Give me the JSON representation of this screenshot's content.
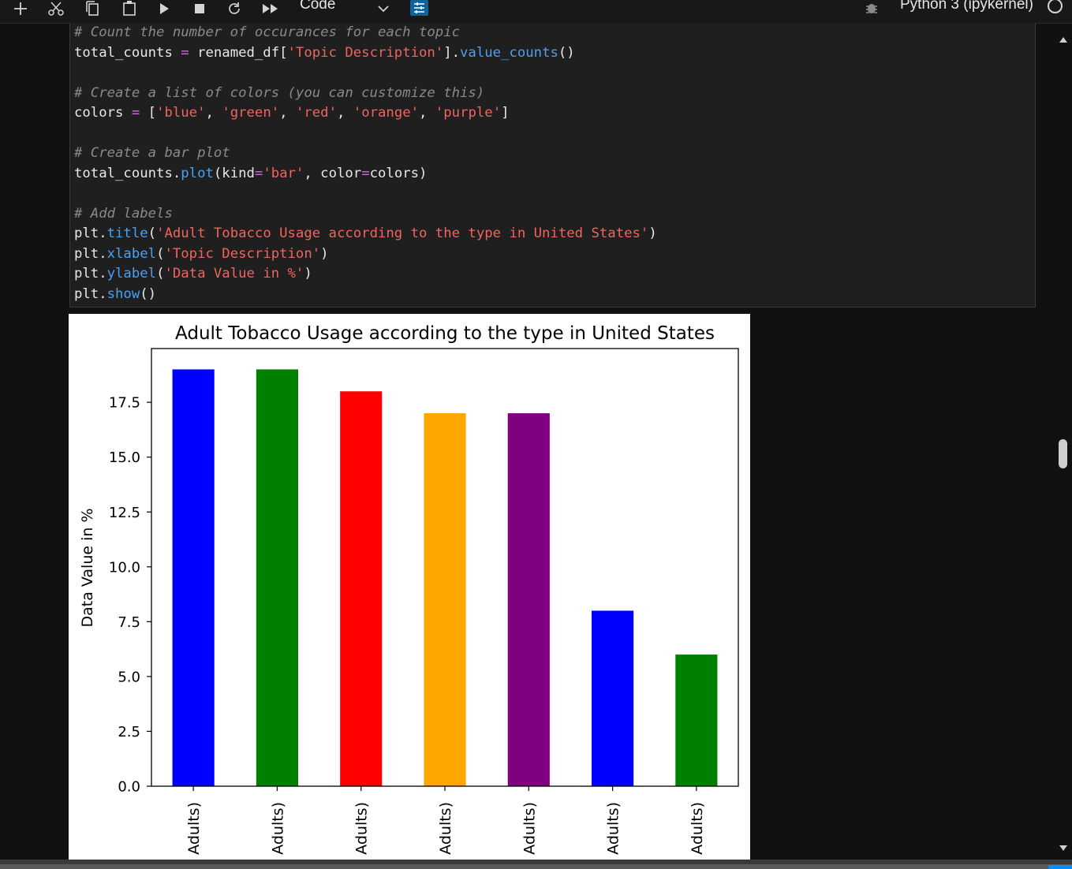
{
  "toolbar": {
    "cell_type": "Code",
    "kernel": "Python 3 (ipykernel)"
  },
  "code_lines": [
    [
      {
        "t": "# Count the number of occurances for each topic",
        "c": "cm"
      }
    ],
    [
      {
        "t": "total_counts ",
        "c": "pl"
      },
      {
        "t": "=",
        "c": "op"
      },
      {
        "t": " renamed_df[",
        "c": "pl"
      },
      {
        "t": "'Topic Description'",
        "c": "st"
      },
      {
        "t": "].",
        "c": "pl"
      },
      {
        "t": "value_counts",
        "c": "fn"
      },
      {
        "t": "()",
        "c": "pl"
      }
    ],
    [],
    [
      {
        "t": "# Create a list of colors (you can customize this)",
        "c": "cm"
      }
    ],
    [
      {
        "t": "colors ",
        "c": "pl"
      },
      {
        "t": "=",
        "c": "op"
      },
      {
        "t": " [",
        "c": "pl"
      },
      {
        "t": "'blue'",
        "c": "st"
      },
      {
        "t": ", ",
        "c": "pl"
      },
      {
        "t": "'green'",
        "c": "st"
      },
      {
        "t": ", ",
        "c": "pl"
      },
      {
        "t": "'red'",
        "c": "st"
      },
      {
        "t": ", ",
        "c": "pl"
      },
      {
        "t": "'orange'",
        "c": "st"
      },
      {
        "t": ", ",
        "c": "pl"
      },
      {
        "t": "'purple'",
        "c": "st"
      },
      {
        "t": "]",
        "c": "pl"
      }
    ],
    [],
    [
      {
        "t": "# Create a bar plot",
        "c": "cm"
      }
    ],
    [
      {
        "t": "total_counts.",
        "c": "pl"
      },
      {
        "t": "plot",
        "c": "fn"
      },
      {
        "t": "(kind",
        "c": "pl"
      },
      {
        "t": "=",
        "c": "op"
      },
      {
        "t": "'bar'",
        "c": "st"
      },
      {
        "t": ", color",
        "c": "pl"
      },
      {
        "t": "=",
        "c": "op"
      },
      {
        "t": "colors)",
        "c": "pl"
      }
    ],
    [],
    [
      {
        "t": "# Add labels",
        "c": "cm"
      }
    ],
    [
      {
        "t": "plt.",
        "c": "pl"
      },
      {
        "t": "title",
        "c": "fn"
      },
      {
        "t": "(",
        "c": "pl"
      },
      {
        "t": "'Adult Tobacco Usage according to the type in United States'",
        "c": "st"
      },
      {
        "t": ")",
        "c": "pl"
      }
    ],
    [
      {
        "t": "plt.",
        "c": "pl"
      },
      {
        "t": "xlabel",
        "c": "fn"
      },
      {
        "t": "(",
        "c": "pl"
      },
      {
        "t": "'Topic Description'",
        "c": "st"
      },
      {
        "t": ")",
        "c": "pl"
      }
    ],
    [
      {
        "t": "plt.",
        "c": "pl"
      },
      {
        "t": "ylabel",
        "c": "fn"
      },
      {
        "t": "(",
        "c": "pl"
      },
      {
        "t": "'Data Value in %'",
        "c": "st"
      },
      {
        "t": ")",
        "c": "pl"
      }
    ],
    [
      {
        "t": "plt.",
        "c": "pl"
      },
      {
        "t": "show",
        "c": "fn"
      },
      {
        "t": "()",
        "c": "pl"
      }
    ]
  ],
  "chart_data": {
    "type": "bar",
    "title": "Adult Tobacco Usage according to the type in United States",
    "xlabel": "",
    "ylabel": "Data Value in %",
    "categories": [
      "Adults)",
      "Adults)",
      "Adults)",
      "Adults)",
      "Adults)",
      "Adults)",
      "Adults)"
    ],
    "values": [
      19,
      19,
      18,
      17,
      17,
      8,
      6
    ],
    "colors": [
      "#0000ff",
      "#008000",
      "#ff0000",
      "#ffa500",
      "#800080",
      "#0000ff",
      "#008000"
    ],
    "yticks": [
      "0.0",
      "2.5",
      "5.0",
      "7.5",
      "10.0",
      "12.5",
      "15.0",
      "17.5"
    ],
    "ytick_values": [
      0,
      2.5,
      5,
      7.5,
      10,
      12.5,
      15,
      17.5
    ],
    "ylim": [
      0,
      19.95
    ],
    "grid": false,
    "legend": "none"
  }
}
